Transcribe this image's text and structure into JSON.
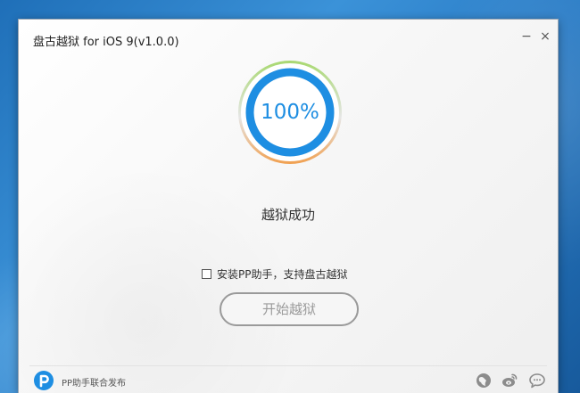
{
  "window": {
    "title": "盘古越狱 for iOS 9(v1.0.0)",
    "minimize_glyph": "−",
    "close_glyph": "×"
  },
  "progress": {
    "text": "100%",
    "value": 100,
    "color": "#1e8ee2"
  },
  "status": {
    "text": "越狱成功"
  },
  "install_option": {
    "label": "安装PP助手，支持盘古越狱",
    "checked": false
  },
  "start_button": {
    "label": "开始越狱"
  },
  "footer": {
    "text": "PP助手联合发布",
    "logo": "pp-logo-icon",
    "icons": [
      "globe-icon",
      "weibo-icon",
      "chat-icon"
    ]
  },
  "colors": {
    "accent": "#1e8ee2",
    "ring_top": "#a8d870",
    "ring_bottom": "#f0a050"
  }
}
